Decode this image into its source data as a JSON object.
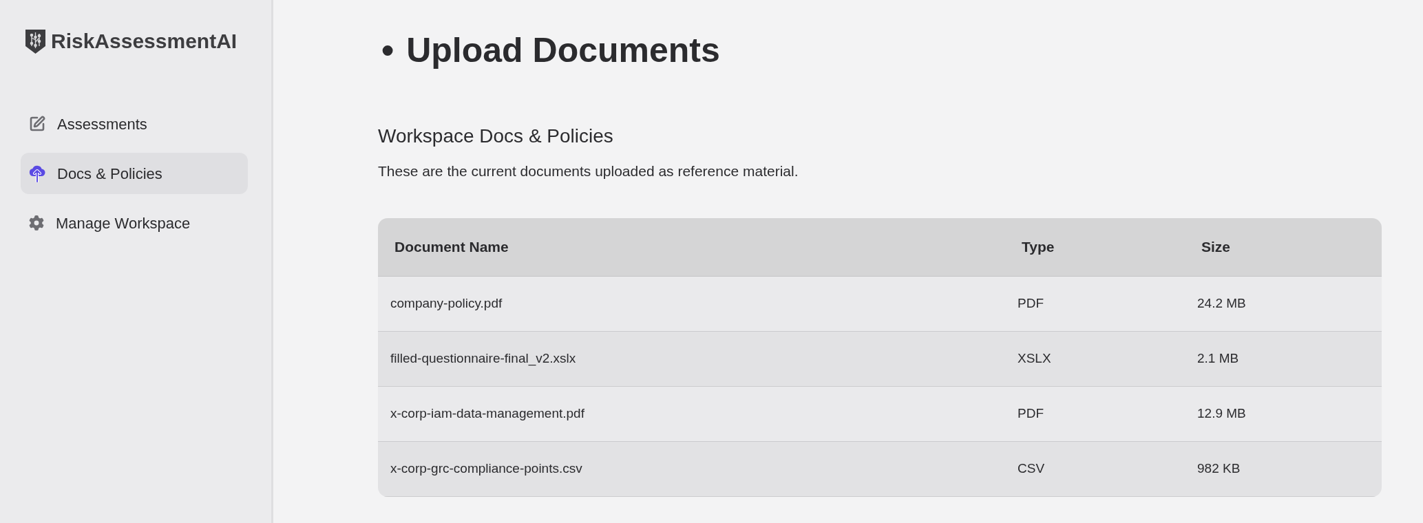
{
  "sidebar": {
    "logo": {
      "text": "RiskAssessmentAI"
    },
    "items": [
      {
        "label": "Assessments",
        "selected": false
      },
      {
        "label": "Docs & Policies",
        "selected": true
      },
      {
        "label": "Manage Workspace",
        "selected": false
      }
    ]
  },
  "heading": {
    "bullet": "•",
    "text": "Upload Documents"
  },
  "section": {
    "title": "Workspace Docs & Policies",
    "description": "These are the current documents uploaded as reference material."
  },
  "table": {
    "columns": [
      "Document Name",
      "Type",
      "Size"
    ],
    "rows": [
      [
        "company-policy.pdf",
        "PDF",
        "24.2 MB"
      ],
      [
        "filled-questionnaire-final_v2.xslx",
        "XSLX",
        "2.1 MB"
      ],
      [
        "x-corp-iam-data-management.pdf",
        "PDF",
        "12.9 MB"
      ],
      [
        "x-corp-grc-compliance-points.csv",
        "CSV",
        "982 KB"
      ]
    ]
  }
}
